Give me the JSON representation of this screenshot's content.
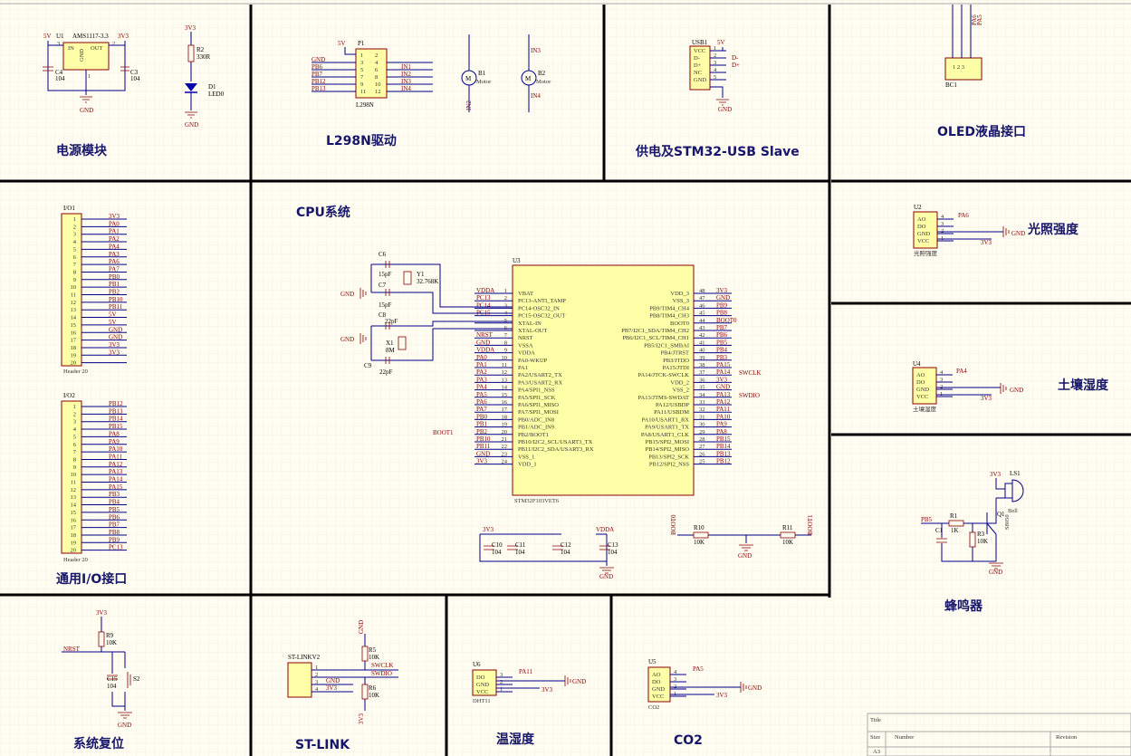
{
  "sections": {
    "power": "电源模块",
    "l298n": "L298N驱动",
    "usb": "供电及STM32-USB Slave",
    "oled": "OLED液晶接口",
    "light": "光照强度",
    "cpu": "CPU系统",
    "io": "通用I/O接口",
    "soil": "土壤湿度",
    "buzzer": "蜂鸣器",
    "reset": "系统复位",
    "stlink": "ST-LINK",
    "humidity": "温湿度",
    "co2": "CO2"
  },
  "power": {
    "u1_ref": "U1",
    "u1_part": "AMS1117-3.3",
    "u1_in": "IN",
    "u1_out": "OUT",
    "u1_gnd": "GND",
    "v5": "5V",
    "v33": "3V3",
    "c4": "C4",
    "c4v": "104",
    "c3": "C3",
    "c3v": "104",
    "gnd": "GND",
    "r2": "R2",
    "r2v": "330R",
    "d1": "D1",
    "d1v": "LED0",
    "led_v": "3V3",
    "led_gnd": "GND",
    "pin3": "3",
    "pin2": "2",
    "pin1": "1"
  },
  "l298n": {
    "p1": "P1",
    "part": "L298N",
    "v5": "5V",
    "gnd": "GND",
    "left_nets": [
      "GND",
      "PB6",
      "PB7",
      "PB12",
      "PB13"
    ],
    "right_nets": [
      "",
      "IN1",
      "IN2",
      "IN3",
      "IN4"
    ],
    "pins_left": [
      "1",
      "3",
      "5",
      "7",
      "9",
      "11"
    ],
    "pins_right": [
      "2",
      "4",
      "6",
      "8",
      "10",
      "12"
    ],
    "b1": "B1",
    "b2": "B2",
    "motor": "Motor",
    "in1": "IN1",
    "in2": "IN2",
    "in3": "IN3",
    "in4": "IN4"
  },
  "usb": {
    "ref": "USB1",
    "pins": [
      "VCC",
      "D-",
      "D+",
      "NC",
      "GND"
    ],
    "nums": [
      "1",
      "2",
      "3",
      "4",
      "5"
    ],
    "v5": "5V",
    "dm": "D-",
    "dp": "D+",
    "gnd": "GND"
  },
  "oled": {
    "ref": "BC1",
    "nets": [
      "3V3",
      "PA5",
      "PA6"
    ]
  },
  "light": {
    "ref": "U2",
    "pins": [
      "AO",
      "DO",
      "GND",
      "VCC"
    ],
    "nums": [
      "4",
      "3",
      "2",
      "1"
    ],
    "net_ao": "PA6",
    "net_gnd": "GND",
    "net_vcc": "3V3",
    "caption": "光照强度"
  },
  "soil": {
    "ref": "U4",
    "pins": [
      "AO",
      "DO",
      "GND",
      "VCC"
    ],
    "nums": [
      "4",
      "3",
      "2",
      "1"
    ],
    "net_ao": "PA4",
    "net_gnd": "GND",
    "net_vcc": "3V3",
    "caption": "土壤湿度"
  },
  "cpu": {
    "ref": "U3",
    "part": "STM32F103VET6",
    "c6": "C6",
    "c6v": "15pF",
    "c7": "C7",
    "c7v": "15pF",
    "y1": "Y1",
    "y1v": "32.768K",
    "c8": "C8",
    "c8v": "22pF",
    "c9": "C9",
    "c9v": "22pF",
    "x1": "X1",
    "x1v": "8M",
    "gnd": "GND",
    "left_pins": [
      {
        "num": "1",
        "name": "VBAT",
        "net": "VDDA"
      },
      {
        "num": "2",
        "name": "PC13-ANTI_TAMP",
        "net": "PC13"
      },
      {
        "num": "3",
        "name": "PC14-OSC32_IN",
        "net": "PC14"
      },
      {
        "num": "4",
        "name": "PC15-OSC32_OUT",
        "net": "PC15"
      },
      {
        "num": "5",
        "name": "XTAL-IN",
        "net": ""
      },
      {
        "num": "6",
        "name": "XTAL-OUT",
        "net": ""
      },
      {
        "num": "7",
        "name": "NRST",
        "net": "NRST"
      },
      {
        "num": "8",
        "name": "VSSA",
        "net": "GND"
      },
      {
        "num": "9",
        "name": "VDDA",
        "net": "VDDA"
      },
      {
        "num": "10",
        "name": "PA0-WKUP",
        "net": "PA0"
      },
      {
        "num": "11",
        "name": "PA1",
        "net": "PA1"
      },
      {
        "num": "12",
        "name": "PA2/USART2_TX",
        "net": "PA2"
      },
      {
        "num": "13",
        "name": "PA3/USART2_RX",
        "net": "PA3"
      },
      {
        "num": "14",
        "name": "PA4/SPI1_NSS",
        "net": "PA4"
      },
      {
        "num": "15",
        "name": "PA5/SPI1_SCK",
        "net": "PA5"
      },
      {
        "num": "16",
        "name": "PA6/SPI1_MISO",
        "net": "PA6"
      },
      {
        "num": "17",
        "name": "PA7/SPI1_MOSI",
        "net": "PA7"
      },
      {
        "num": "18",
        "name": "PB0/ADC_IN8",
        "net": "PB0"
      },
      {
        "num": "19",
        "name": "PB1/ADC_IN9",
        "net": "PB1"
      },
      {
        "num": "20",
        "name": "PB2/BOOT1",
        "net": "PB2"
      },
      {
        "num": "21",
        "name": "PB10/I2C2_SCL/USART3_TX",
        "net": "PB10"
      },
      {
        "num": "22",
        "name": "PB11/I2C2_SDA/USART3_RX",
        "net": "PB11"
      },
      {
        "num": "23",
        "name": "VSS_1",
        "net": "GND"
      },
      {
        "num": "24",
        "name": "VDD_1",
        "net": "3V3"
      }
    ],
    "right_pins": [
      {
        "num": "48",
        "name": "VDD_3",
        "net": "3V3"
      },
      {
        "num": "47",
        "name": "VSS_3",
        "net": "GND"
      },
      {
        "num": "46",
        "name": "PB9/TIM4_CH4",
        "net": "PB9"
      },
      {
        "num": "45",
        "name": "PB8/TIM4_CH3",
        "net": "PB8"
      },
      {
        "num": "44",
        "name": "BOOT0",
        "net": "BOOT0"
      },
      {
        "num": "43",
        "name": "PB7/I2C1_SDA/TIM4_CH2",
        "net": "PB7"
      },
      {
        "num": "42",
        "name": "PB6/I2C1_SCL/TIM4_CH1",
        "net": "PB6"
      },
      {
        "num": "41",
        "name": "PB5/I2C1_SMBAI",
        "net": "PB5"
      },
      {
        "num": "40",
        "name": "PB4/JTRST",
        "net": "PB4"
      },
      {
        "num": "39",
        "name": "PB3/JTDO",
        "net": "PB3"
      },
      {
        "num": "38",
        "name": "PA15/JTDI",
        "net": "PA15"
      },
      {
        "num": "37",
        "name": "PA14/JTCK-SWCLK",
        "net": "PA14"
      },
      {
        "num": "36",
        "name": "VDD_2",
        "net": "3V3"
      },
      {
        "num": "35",
        "name": "VSS_2",
        "net": "GND"
      },
      {
        "num": "34",
        "name": "PA13/JTMS-SWDAT",
        "net": "PA13"
      },
      {
        "num": "33",
        "name": "PA12/USBDP",
        "net": "PA12"
      },
      {
        "num": "32",
        "name": "PA11/USBDM",
        "net": "PA11"
      },
      {
        "num": "31",
        "name": "PA10/USART1_RX",
        "net": "PA10"
      },
      {
        "num": "30",
        "name": "PA9/USART1_TX",
        "net": "PA9"
      },
      {
        "num": "29",
        "name": "PA8/USART1_CLK",
        "net": "PA8"
      },
      {
        "num": "28",
        "name": "PB15/SPI2_MOSI",
        "net": "PB15"
      },
      {
        "num": "27",
        "name": "PB14/SPI2_MISO",
        "net": "PB14"
      },
      {
        "num": "26",
        "name": "PB13/SPI2_SCK",
        "net": "PB13"
      },
      {
        "num": "25",
        "name": "PB12/SPI2_NSS",
        "net": "PB12"
      }
    ],
    "swclk": "SWCLK",
    "swdio": "SWDIO",
    "boot1_left": "BOOT1",
    "dec_v33": "3V3",
    "dec_vdda": "VDDA",
    "caps": [
      {
        "ref": "C10",
        "v": "104"
      },
      {
        "ref": "C11",
        "v": "104"
      },
      {
        "ref": "C12",
        "v": "104"
      },
      {
        "ref": "C13",
        "v": "104"
      }
    ],
    "boot0": "BOOT0",
    "boot1": "BOOT1",
    "r10": "R10",
    "r10v": "10K",
    "r11": "R11",
    "r11v": "10K"
  },
  "io": {
    "io1": "I/O1",
    "io2": "I/O2",
    "footer": "Header 20",
    "io1_nets": [
      "3V3",
      "PA0",
      "PA1",
      "PA2",
      "PA4",
      "PA3",
      "PA6",
      "PA7",
      "PB0",
      "PB1",
      "PB2",
      "PB10",
      "PB11",
      "5V",
      "5V",
      "GND",
      "GND",
      "3V3",
      "3V3",
      ""
    ],
    "io2_nets": [
      "PB12",
      "PB13",
      "PB14",
      "PB15",
      "PA8",
      "PA9",
      "PA10",
      "PA11",
      "PA12",
      "PA13",
      "PA14",
      "PA15",
      "PB3",
      "PB4",
      "PB5",
      "PB6",
      "PB7",
      "PB8",
      "PB9",
      "PC13"
    ]
  },
  "buzzer": {
    "ls1": "LS1",
    "v33": "3V3",
    "q1": "Q1",
    "q1v": "S8050",
    "bell": "Bell",
    "pb5": "PB5",
    "r1": "R1",
    "r1v": "1K",
    "r3": "R3",
    "r3v": "10K",
    "c1": "C1",
    "gnd": "GND"
  },
  "reset": {
    "v33": "3V3",
    "r9": "R9",
    "r9v": "10K",
    "nrst": "NRST",
    "c15": "C15",
    "c15v": "104",
    "s2": "S2",
    "gnd": "GND"
  },
  "stlink": {
    "ref": "ST-LINKV2",
    "nums": [
      "1",
      "2",
      "3",
      "4"
    ],
    "gnd": "GND",
    "v33": "3V3",
    "r5": "R5",
    "r5v": "10K",
    "r6": "R6",
    "r6v": "10K",
    "swclk": "SWCLK",
    "swdio": "SWDIO",
    "gnd_top": "GND",
    "v33_bot": "3V3"
  },
  "humidity": {
    "ref": "U6",
    "pins": [
      "DO",
      "GND",
      "VCC"
    ],
    "nums": [
      "3",
      "2",
      "1"
    ],
    "caption": "DHT11",
    "net_do": "PA11",
    "net_gnd": "GND",
    "net_vcc": "3V3"
  },
  "co2": {
    "ref": "U5",
    "pins": [
      "AO",
      "DO",
      "GND",
      "VCC"
    ],
    "nums": [
      "4",
      "3",
      "2",
      "1"
    ],
    "caption": "CO2",
    "net_ao": "PA5",
    "net_gnd": "GND",
    "net_vcc": "3V3"
  },
  "titleblock": {
    "title": "Title",
    "size": "Size",
    "number": "Number",
    "revision": "Revision",
    "a3": "A3"
  }
}
